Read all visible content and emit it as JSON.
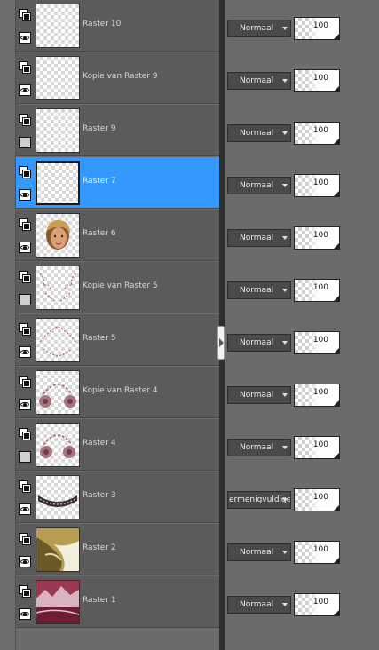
{
  "layers": [
    {
      "name": "Raster 10",
      "blend": "Normaal",
      "opacity": "100",
      "visible": true,
      "selected": false,
      "thumb": "empty"
    },
    {
      "name": "Kopie van Raster 9",
      "blend": "Normaal",
      "opacity": "100",
      "visible": true,
      "selected": false,
      "thumb": "empty"
    },
    {
      "name": "Raster 9",
      "blend": "Normaal",
      "opacity": "100",
      "visible": false,
      "selected": false,
      "thumb": "empty"
    },
    {
      "name": "Raster 7",
      "blend": "Normaal",
      "opacity": "100",
      "visible": true,
      "selected": true,
      "thumb": "empty"
    },
    {
      "name": "Raster 6",
      "blend": "Normaal",
      "opacity": "100",
      "visible": true,
      "selected": false,
      "thumb": "portrait"
    },
    {
      "name": "Kopie van Raster 5",
      "blend": "Normaal",
      "opacity": "100",
      "visible": false,
      "selected": false,
      "thumb": "sparkle"
    },
    {
      "name": "Raster 5",
      "blend": "Normaal",
      "opacity": "100",
      "visible": true,
      "selected": false,
      "thumb": "sparkle"
    },
    {
      "name": "Kopie van Raster 4",
      "blend": "Normaal",
      "opacity": "100",
      "visible": true,
      "selected": false,
      "thumb": "flowers"
    },
    {
      "name": "Raster 4",
      "blend": "Normaal",
      "opacity": "100",
      "visible": false,
      "selected": false,
      "thumb": "flowers"
    },
    {
      "name": "Raster 3",
      "blend": "ermenigvuldige",
      "opacity": "100",
      "visible": true,
      "selected": false,
      "thumb": "lace"
    },
    {
      "name": "Raster 2",
      "blend": "Normaal",
      "opacity": "100",
      "visible": true,
      "selected": false,
      "thumb": "gold"
    },
    {
      "name": "Raster 1",
      "blend": "Normaal",
      "opacity": "100",
      "visible": true,
      "selected": false,
      "thumb": "landscape"
    }
  ],
  "icons": {
    "lock": "layer-lock-icon",
    "visibility": "visibility-eye-icon",
    "dropdown": "chevron-down-icon",
    "collapse": "chevron-right-icon"
  },
  "colors": {
    "selected": "#3399ff",
    "row": "#5b5b5b",
    "panel": "#6b6b6b"
  }
}
